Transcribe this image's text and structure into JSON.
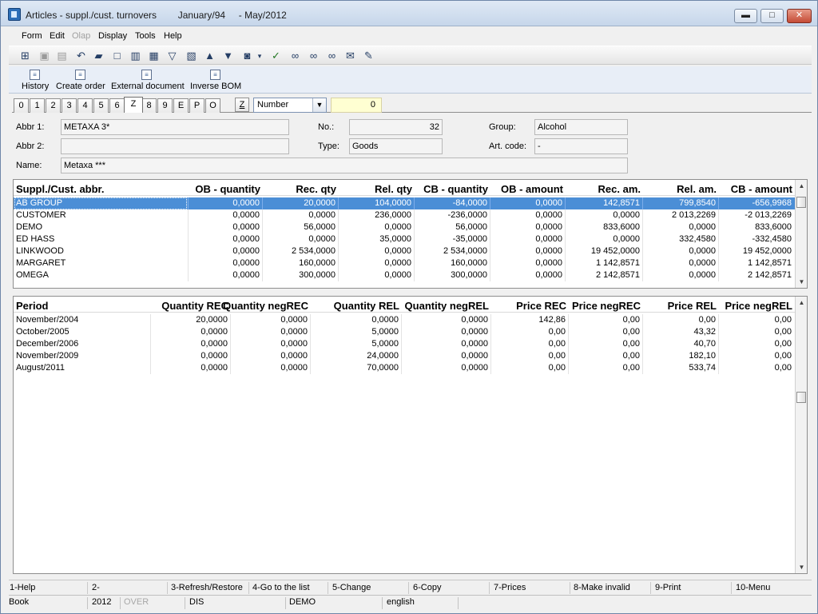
{
  "window": {
    "title": "Articles - suppl./cust. turnovers        January/94     - May/2012",
    "controls": {
      "minimize": "▬",
      "maximize": "□",
      "close": "✕"
    }
  },
  "menu": [
    "Form",
    "Edit",
    "Olap",
    "Display",
    "Tools",
    "Help"
  ],
  "toolbar": {
    "icons": [
      "tree-icon",
      "save-icon",
      "save-all-icon",
      "undo-icon",
      "open-folder-icon",
      "new-document-icon",
      "copy-icon",
      "book-icon",
      "filter-icon",
      "remove-filter-icon",
      "arrow-up-icon",
      "arrow-down-icon",
      "camera-icon",
      "dropdown-arrow-icon",
      "check-icon",
      "binoculars-icon",
      "binoculars-plus-icon",
      "binoculars-next-icon",
      "mail-icon",
      "note-icon"
    ]
  },
  "actions": [
    "History",
    "Create order",
    "External document",
    "Inverse BOM"
  ],
  "tabs": [
    "0",
    "1",
    "2",
    "3",
    "4",
    "5",
    "6",
    "Z",
    "8",
    "9",
    "E",
    "P",
    "O"
  ],
  "selector": {
    "z_button": "Z",
    "option": "Number",
    "value": "0"
  },
  "form": {
    "abbr1_label": "Abbr 1:",
    "abbr1_value": "METAXA 3*",
    "abbr2_label": "Abbr 2:",
    "abbr2_value": "",
    "name_label": "Name:",
    "name_value": "Metaxa ***",
    "no_label": "No.:",
    "no_value": "32",
    "type_label": "Type:",
    "type_value": "Goods",
    "group_label": "Group:",
    "group_value": "Alcohol",
    "artcode_label": "Art. code:",
    "artcode_value": "-"
  },
  "top_grid": {
    "headers": [
      "Suppl./Cust. abbr.",
      "OB - quantity",
      "Rec. qty",
      "Rel. qty",
      "CB - quantity",
      "OB - amount",
      "Rec. am.",
      "Rel. am.",
      "CB - amount"
    ],
    "rows": [
      [
        "AB GROUP",
        "0,0000",
        "20,0000",
        "104,0000",
        "-84,0000",
        "0,0000",
        "142,8571",
        "799,8540",
        "-656,9968"
      ],
      [
        "CUSTOMER",
        "0,0000",
        "0,0000",
        "236,0000",
        "-236,0000",
        "0,0000",
        "0,0000",
        "2 013,2269",
        "-2 013,2269"
      ],
      [
        "DEMO",
        "0,0000",
        "56,0000",
        "0,0000",
        "56,0000",
        "0,0000",
        "833,6000",
        "0,0000",
        "833,6000"
      ],
      [
        "ED HASS",
        "0,0000",
        "0,0000",
        "35,0000",
        "-35,0000",
        "0,0000",
        "0,0000",
        "332,4580",
        "-332,4580"
      ],
      [
        "LINKWOOD",
        "0,0000",
        "2 534,0000",
        "0,0000",
        "2 534,0000",
        "0,0000",
        "19 452,0000",
        "0,0000",
        "19 452,0000"
      ],
      [
        "MARGARET",
        "0,0000",
        "160,0000",
        "0,0000",
        "160,0000",
        "0,0000",
        "1 142,8571",
        "0,0000",
        "1 142,8571"
      ],
      [
        "OMEGA",
        "0,0000",
        "300,0000",
        "0,0000",
        "300,0000",
        "0,0000",
        "2 142,8571",
        "0,0000",
        "2 142,8571"
      ]
    ]
  },
  "bottom_grid": {
    "headers": [
      "Period",
      "Quantity REC",
      "Quantity negREC",
      "Quantity REL",
      "Quantity negREL",
      "Price REC",
      "Price negREC",
      "Price REL",
      "Price negREL"
    ],
    "rows": [
      [
        "November/2004",
        "20,0000",
        "0,0000",
        "0,0000",
        "0,0000",
        "142,86",
        "0,00",
        "0,00",
        "0,00"
      ],
      [
        "October/2005",
        "0,0000",
        "0,0000",
        "5,0000",
        "0,0000",
        "0,00",
        "0,00",
        "43,32",
        "0,00"
      ],
      [
        "December/2006",
        "0,0000",
        "0,0000",
        "5,0000",
        "0,0000",
        "0,00",
        "0,00",
        "40,70",
        "0,00"
      ],
      [
        "November/2009",
        "0,0000",
        "0,0000",
        "24,0000",
        "0,0000",
        "0,00",
        "0,00",
        "182,10",
        "0,00"
      ],
      [
        "August/2011",
        "0,0000",
        "0,0000",
        "70,0000",
        "0,0000",
        "0,00",
        "0,00",
        "533,74",
        "0,00"
      ]
    ]
  },
  "function_keys": [
    "1-Help",
    "2-",
    "3-Refresh/Restore",
    "4-Go to the list",
    "5-Change",
    "6-Copy",
    "7-Prices",
    "8-Make invalid",
    "9-Print",
    "10-Menu"
  ],
  "status_bar": {
    "mode": "Book",
    "year": "2012",
    "overwrite": "OVER",
    "dis": "DIS",
    "database": "DEMO",
    "language": "english"
  }
}
